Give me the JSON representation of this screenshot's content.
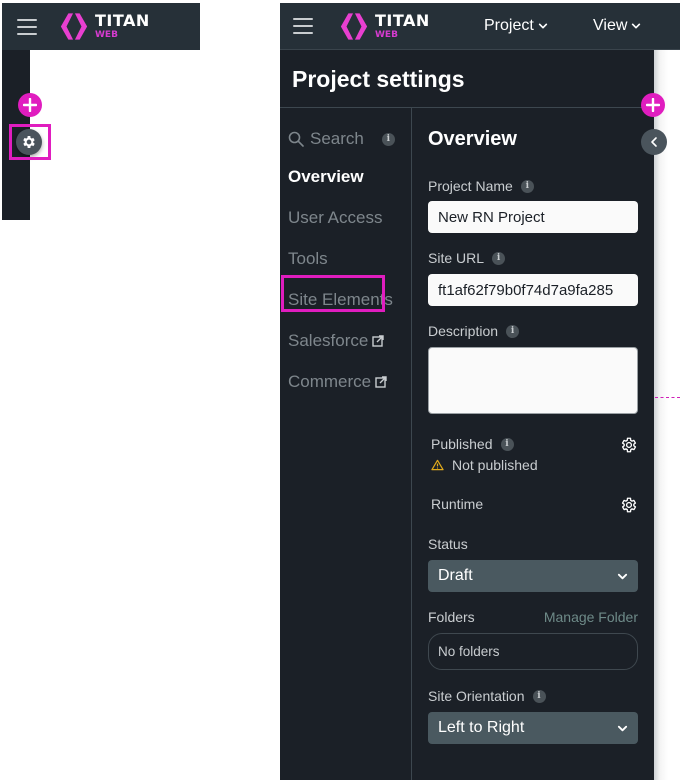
{
  "brand": {
    "title": "TITAN",
    "subtitle": "WEB",
    "accent_color": "#e01dbf"
  },
  "mini_panel": {
    "icons": [
      "menu-icon",
      "titan-logo",
      "plus-icon",
      "gear-icon"
    ]
  },
  "header": {
    "menus": [
      {
        "label": "Project"
      },
      {
        "label": "View"
      }
    ]
  },
  "page": {
    "title": "Project settings"
  },
  "sidebar": {
    "search_placeholder": "Search",
    "items": [
      {
        "label": "Overview",
        "active": true
      },
      {
        "label": "User Access"
      },
      {
        "label": "Tools"
      },
      {
        "label": "Site Elements"
      },
      {
        "label": "Salesforce",
        "external": true,
        "highlighted": true
      },
      {
        "label": "Commerce",
        "external": true
      }
    ]
  },
  "overview": {
    "title": "Overview",
    "project_name": {
      "label": "Project Name",
      "value": "New RN Project"
    },
    "site_url": {
      "label": "Site URL",
      "value": "ft1af62f79b0f74d7a9fa285"
    },
    "description": {
      "label": "Description",
      "value": ""
    },
    "published": {
      "label": "Published",
      "status": "Not published"
    },
    "runtime": {
      "label": "Runtime"
    },
    "status": {
      "label": "Status",
      "selected": "Draft"
    },
    "folders": {
      "label": "Folders",
      "manage_link": "Manage Folder",
      "value": "No folders"
    },
    "site_orientation": {
      "label": "Site Orientation",
      "selected": "Left to Right"
    }
  },
  "info_glyph": "i"
}
